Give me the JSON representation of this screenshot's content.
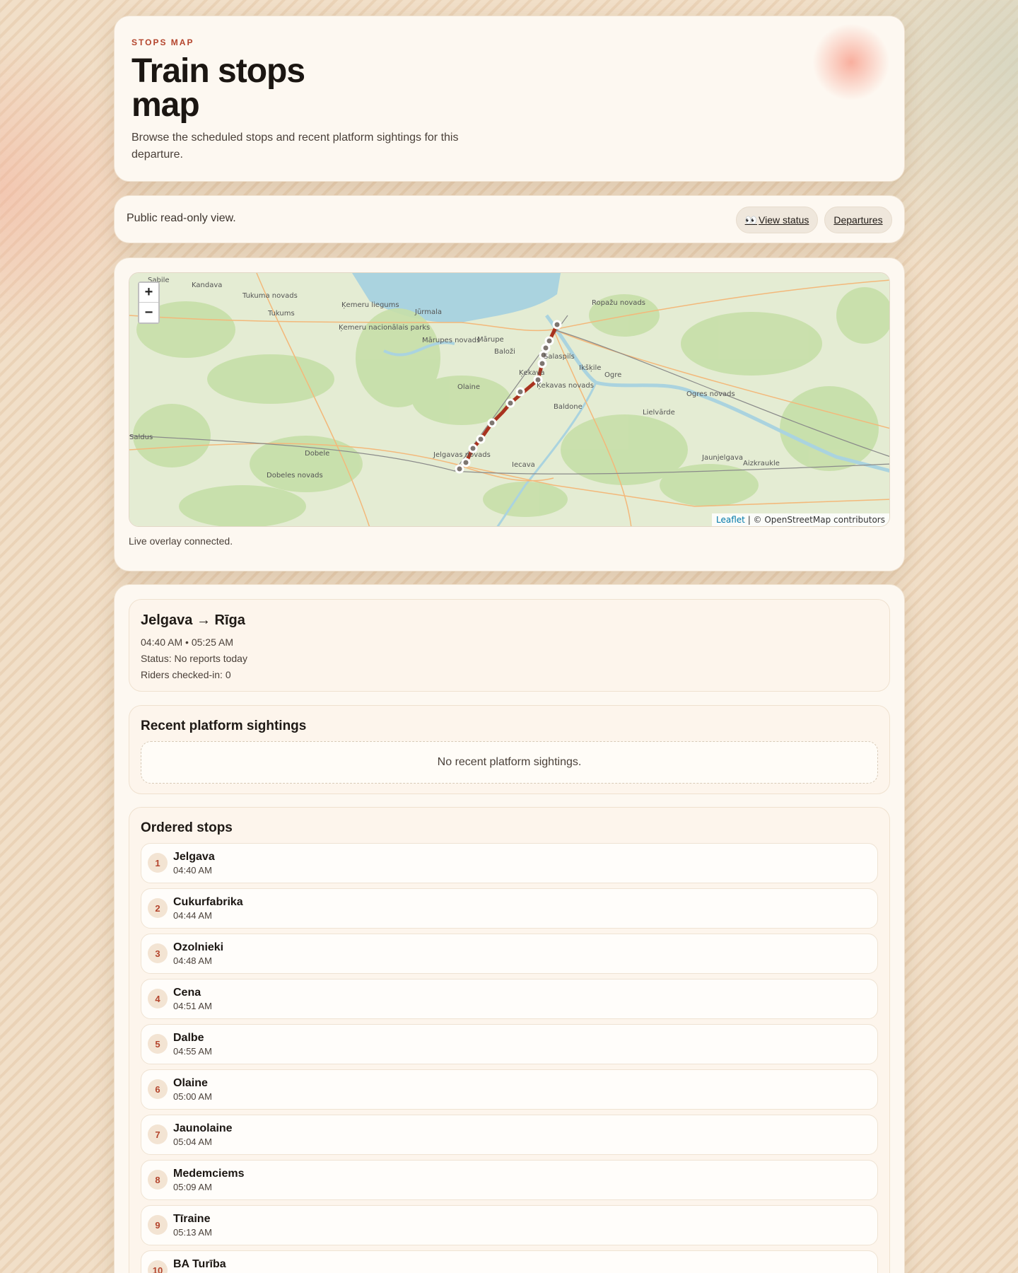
{
  "hero": {
    "eyebrow": "STOPS MAP",
    "title": "Train stops map",
    "description": "Browse the scheduled stops and recent platform sightings for this departure."
  },
  "toolbar": {
    "note": "Public read-only view.",
    "status_label": "View status",
    "status_icon": "👀",
    "departures_label": "Departures"
  },
  "map": {
    "zoom_in": "+",
    "zoom_out": "−",
    "attribution_link": "Leaflet",
    "attribution_rest": " | © OpenStreetMap contributors",
    "places": [
      "Sabile",
      "Kandava",
      "Tukuma novads",
      "Tukums",
      "Ķemeru liegums",
      "Ķemeru nacionālais parks",
      "Jūrmala",
      "Mārupes novads",
      "Mārupe",
      "Baloži",
      "Salaspils",
      "Ropažu novads",
      "Ikšķile",
      "Ogre",
      "Ķekava",
      "Ķekavas novads",
      "Baldone",
      "Ogres novads",
      "Lielvārde",
      "Saldus",
      "Dobele",
      "Jelgavas novads",
      "Iecava",
      "Jaunjelgava",
      "Aizkraukle",
      "Dobeles novads",
      "Olaine"
    ],
    "overlay_status": "Live overlay connected."
  },
  "colors": {
    "accent": "#b4452d",
    "route": "#a8321e",
    "card": "#fdf8f1"
  },
  "trip": {
    "title": "Jelgava → Rīga",
    "times": "04:40 AM • 05:25 AM",
    "status": "Status: No reports today",
    "riders": "Riders checked-in: 0"
  },
  "sightings": {
    "heading": "Recent platform sightings",
    "empty": "No recent platform sightings."
  },
  "stops": {
    "heading": "Ordered stops",
    "items": [
      {
        "n": "1",
        "name": "Jelgava",
        "time": "04:40 AM"
      },
      {
        "n": "2",
        "name": "Cukurfabrika",
        "time": "04:44 AM"
      },
      {
        "n": "3",
        "name": "Ozolnieki",
        "time": "04:48 AM"
      },
      {
        "n": "4",
        "name": "Cena",
        "time": "04:51 AM"
      },
      {
        "n": "5",
        "name": "Dalbe",
        "time": "04:55 AM"
      },
      {
        "n": "6",
        "name": "Olaine",
        "time": "05:00 AM"
      },
      {
        "n": "7",
        "name": "Jaunolaine",
        "time": "05:04 AM"
      },
      {
        "n": "8",
        "name": "Medemciems",
        "time": "05:09 AM"
      },
      {
        "n": "9",
        "name": "Tīraine",
        "time": "05:13 AM"
      },
      {
        "n": "10",
        "name": "BA Turība",
        "time": ""
      }
    ]
  }
}
